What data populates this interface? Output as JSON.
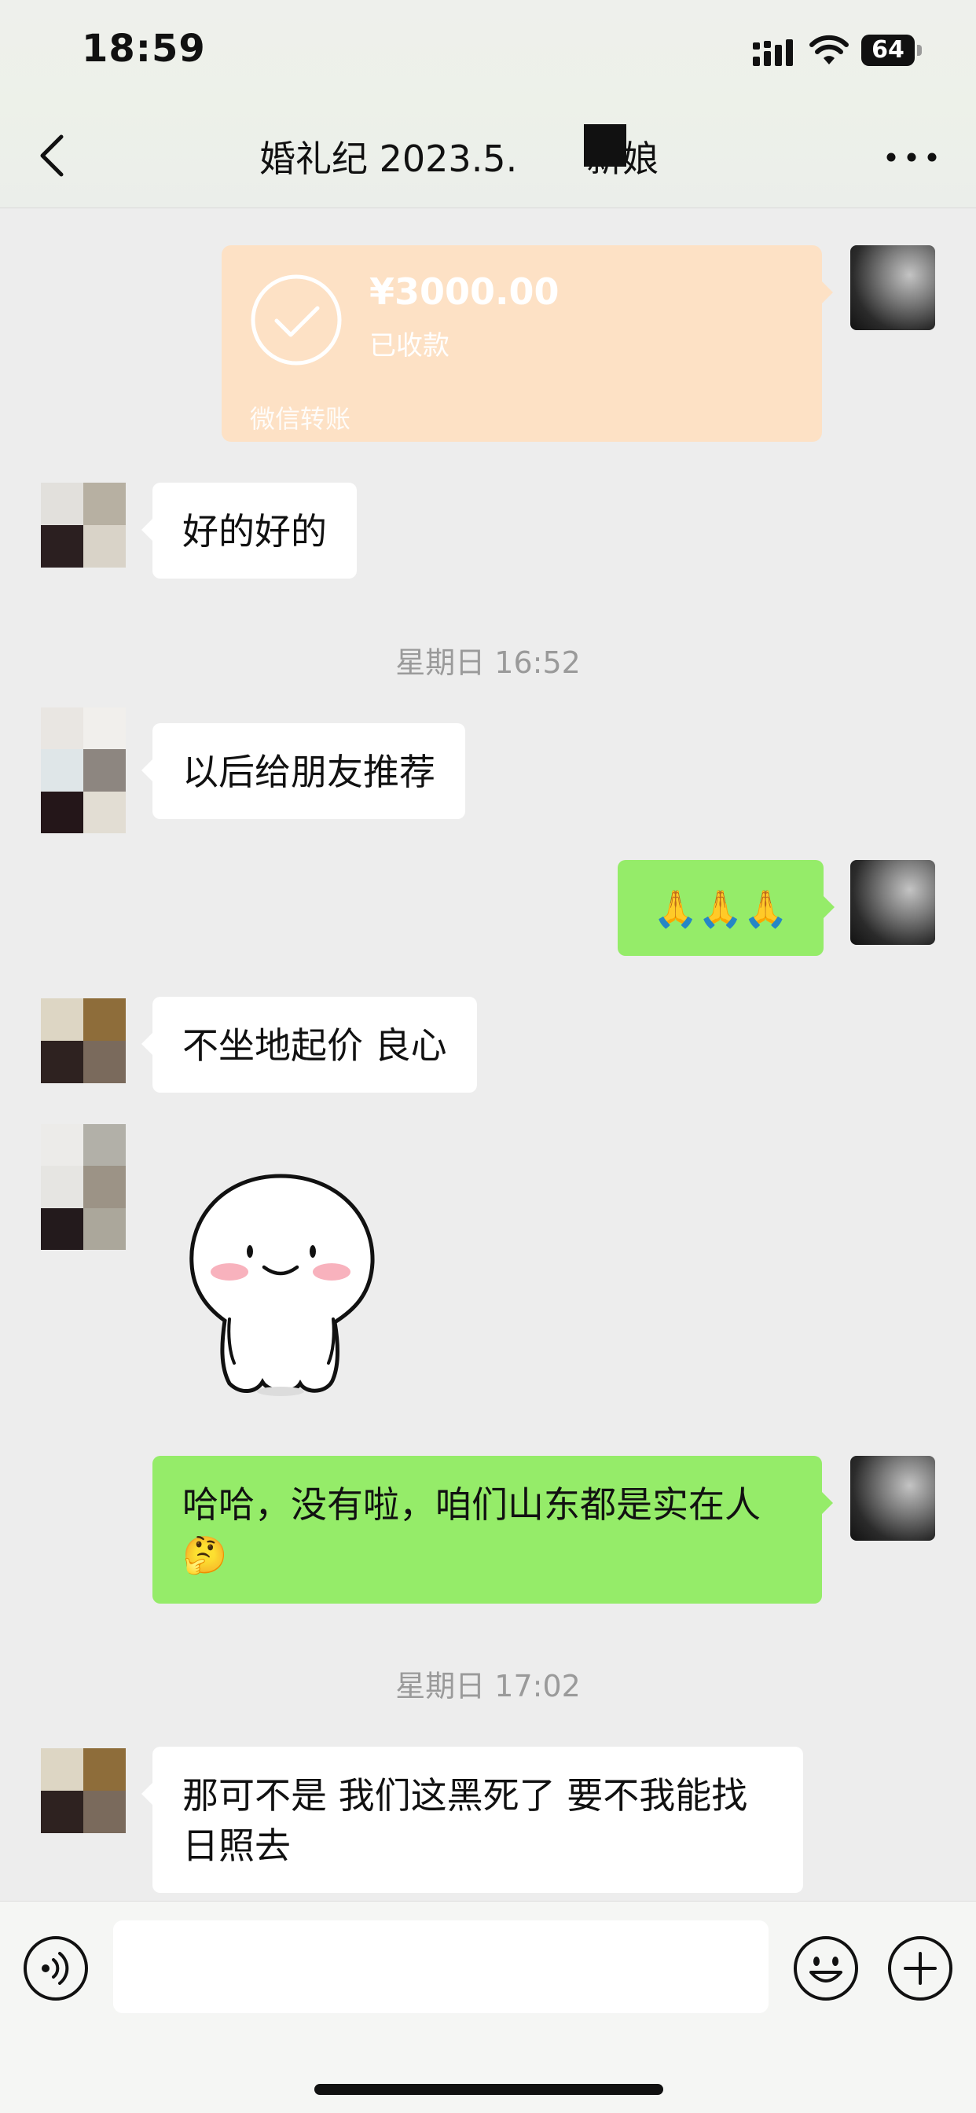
{
  "status_bar": {
    "time": "18:59",
    "battery": "64"
  },
  "header": {
    "title_prefix": "婚礼纪 2023.5.",
    "title_suffix": "新娘",
    "back_icon": "chevron-left-icon",
    "more_icon": "ellipsis-icon"
  },
  "transfer": {
    "amount": "¥3000.00",
    "status": "已收款",
    "footer": "微信转账",
    "icon": "check-circle-icon"
  },
  "messages": [
    {
      "side": "in",
      "text": "好的好的"
    },
    {
      "side": "in",
      "text": "以后给朋友推荐"
    },
    {
      "side": "out",
      "text": "🙏🙏🙏"
    },
    {
      "side": "in",
      "text": "不坐地起价 良心"
    },
    {
      "side": "in",
      "type": "sticker",
      "sticker": "smiling-blob-sticker"
    },
    {
      "side": "out",
      "text": "哈哈，没有啦，咱们山东都是实在人🤔"
    },
    {
      "side": "in",
      "text": "那可不是 我们这黑死了 要不我能找日照去"
    }
  ],
  "timestamps": [
    "星期日 16:52",
    "星期日 17:02"
  ],
  "input_bar": {
    "placeholder": "",
    "voice_icon": "voice-icon",
    "emoji_icon": "emoji-icon",
    "plus_icon": "plus-icon"
  },
  "colors": {
    "outgoing_bubble": "#95ec69",
    "incoming_bubble": "#ffffff",
    "transfer_card": "#fde1c5",
    "background": "#ededed"
  }
}
